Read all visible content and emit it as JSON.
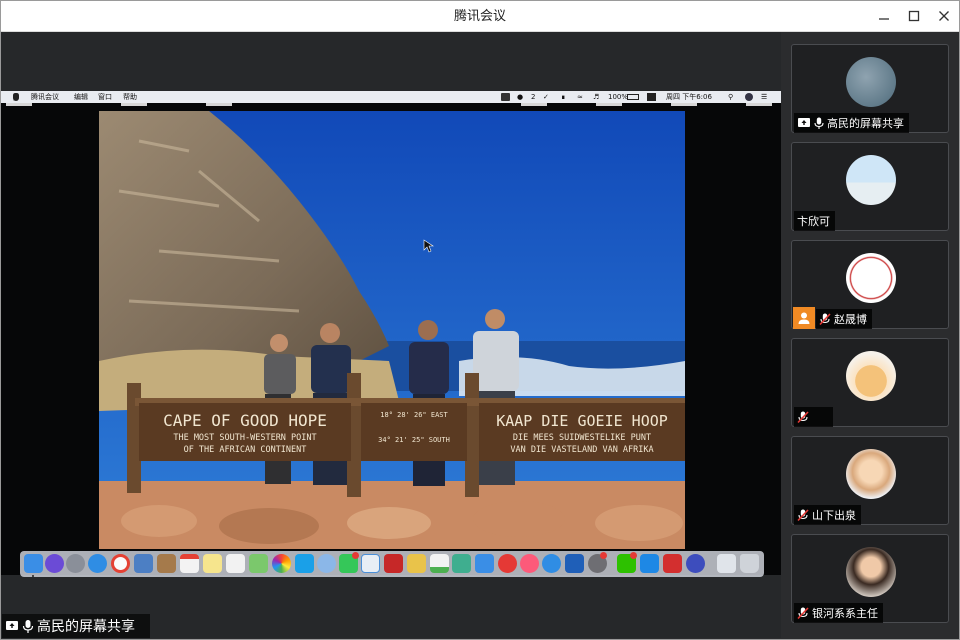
{
  "window": {
    "title": "腾讯会议"
  },
  "mac_menubar": {
    "items": [
      "腾讯会议",
      "编辑",
      "窗口",
      "帮助"
    ],
    "battery": "100%",
    "clock": "周四 下午6:06",
    "wechat_count": "2"
  },
  "sign": {
    "left_title": "CAPE OF GOOD HOPE",
    "left_sub1": "THE MOST SOUTH-WESTERN POINT",
    "left_sub2": "OF THE AFRICAN CONTINENT",
    "coord_top": "18° 28' 26\" EAST",
    "coord_bottom": "34° 21' 25\" SOUTH",
    "right_title": "KAAP DIE GOEIE HOOP",
    "right_sub1": "DIE MEES SUIDWESTELIKE PUNT",
    "right_sub2": "VAN DIE VASTELAND VAN AFRIKA"
  },
  "share_label": "高民的屏幕共享",
  "participants": [
    {
      "name": "高民的屏幕共享",
      "type": "screen-share"
    },
    {
      "name": "卞欣可",
      "type": "normal"
    },
    {
      "name": "赵晟博",
      "type": "host"
    },
    {
      "name": "",
      "type": "muted"
    },
    {
      "name": "山下出泉",
      "type": "muted"
    },
    {
      "name": "银河系系主任",
      "type": "muted"
    }
  ],
  "colors": {
    "accent": "#f08a24",
    "sky": "#1f62c8",
    "sign_wood": "#5a3a22"
  }
}
